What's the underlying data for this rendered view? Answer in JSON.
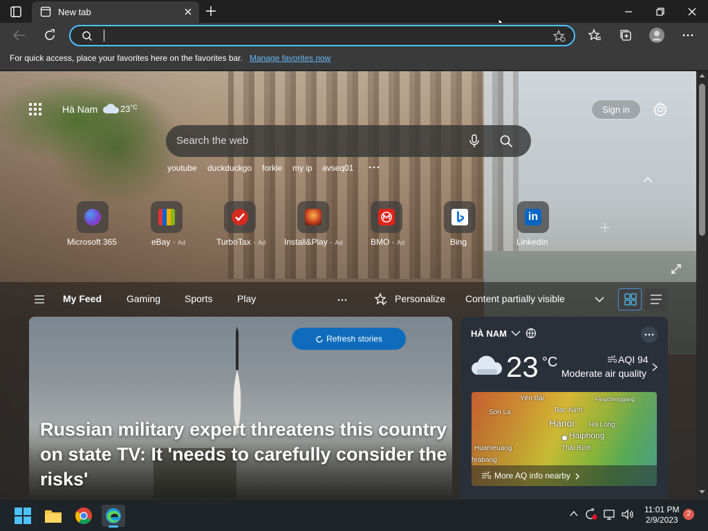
{
  "browser": {
    "tab_title": "New tab",
    "address_value": "",
    "favorites_message": "For quick access, place your favorites here on the favorites bar.",
    "favorites_link": "Manage favorites now"
  },
  "newtab": {
    "location": "Hà Nam",
    "temperature": "23",
    "temp_unit": "°C",
    "sign_in": "Sign in",
    "search_placeholder": "Search the web",
    "suggestions": [
      "youtube",
      "duckduckgo",
      "forkie",
      "my ip",
      "avseq01"
    ],
    "tiles": [
      {
        "label": "Microsoft 365",
        "ad": ""
      },
      {
        "label": "eBay",
        "ad": "Ad"
      },
      {
        "label": "TurboTax",
        "ad": "Ad"
      },
      {
        "label": "Install&Play",
        "ad": "Ad"
      },
      {
        "label": "BMO",
        "ad": "Ad"
      },
      {
        "label": "Bing",
        "ad": ""
      },
      {
        "label": "LinkedIn",
        "ad": ""
      }
    ]
  },
  "feed": {
    "tabs": [
      "My Feed",
      "Gaming",
      "Sports",
      "Play"
    ],
    "personalize": "Personalize",
    "content_setting": "Content partially visible",
    "refresh": "Refresh stories",
    "headline": "Russian military expert threatens this country on state TV: It 'needs to carefully consider the risks'"
  },
  "weather": {
    "location": "HÀ NAM",
    "temperature": "23",
    "unit": "°C",
    "aqi": "AQI 94",
    "air_quality": "Moderate air quality",
    "map_labels": [
      "Yên Bái",
      "Bac Ninh",
      "Fangchenggang",
      "Son La",
      "Hanoi",
      "Ha Long",
      "Haiphong",
      "Huameuang",
      "Thái Bình",
      "hrabang"
    ],
    "more_link": "More AQ info nearby"
  },
  "taskbar": {
    "time": "11:01 PM",
    "date": "2/9/2023",
    "notifications": "2"
  },
  "colors": {
    "accent": "#0f6cbd",
    "address_focus": "#4cc2ff",
    "link": "#62b9f5"
  }
}
